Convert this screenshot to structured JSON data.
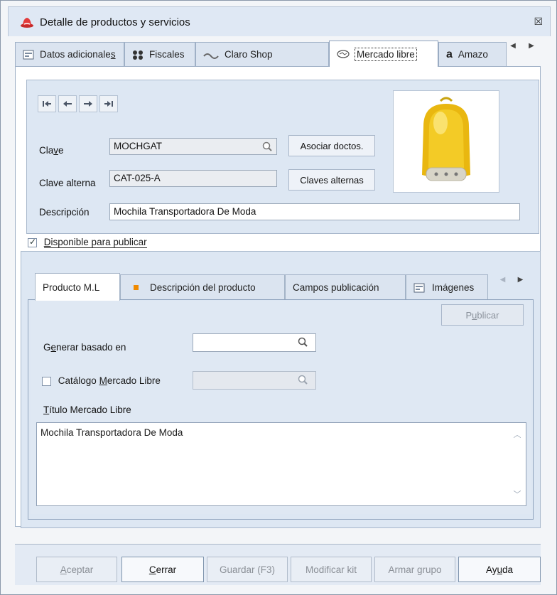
{
  "window": {
    "title": "Detalle de productos y servicios",
    "close_glyph": "☒"
  },
  "top_tabs": [
    {
      "label_pre": "Datos adicionale",
      "label_u": "s",
      "icon": "form-icon"
    },
    {
      "label": "Fiscales",
      "icon": "dots-icon"
    },
    {
      "label": "Claro Shop",
      "icon": "claro-icon"
    },
    {
      "label": "Mercado libre",
      "icon": "handshake-icon"
    },
    {
      "label": "Amazo",
      "icon": "amazon-icon"
    }
  ],
  "navigation": {
    "first": "first-record",
    "prev": "previous-record",
    "next": "next-record",
    "last": "last-record"
  },
  "fields": {
    "clave_label_pre": "Cla",
    "clave_label_u": "v",
    "clave_label_post": "e",
    "clave_value": "MOCHGAT",
    "clave_alterna_label": "Clave alterna",
    "clave_alterna_value": "CAT-025-A",
    "descripcion_label": "Descripción",
    "descripcion_value": "Mochila Transportadora De Moda"
  },
  "buttons": {
    "asociar": "Asociar doctos.",
    "claves_alternas": "Claves alternas"
  },
  "disponible": {
    "label_u": "D",
    "label_rest": "isponible para publicar",
    "checked": true
  },
  "inner_tabs": [
    "Producto M.L",
    "Descripción del producto",
    "Campos publicación",
    "Imágenes"
  ],
  "publicar": {
    "pre": "P",
    "u": "u",
    "post": "blicar"
  },
  "generar": {
    "pre": "G",
    "u": "e",
    "post": "nerar basado en",
    "value": ""
  },
  "catalogo": {
    "pre": "Catálogo ",
    "u": "M",
    "post": "ercado Libre",
    "checked": false
  },
  "titulo": {
    "u": "T",
    "post": "ítulo Mercado Libre",
    "value": "Mochila Transportadora De Moda"
  },
  "bottom_buttons": {
    "aceptar": {
      "u": "A",
      "rest": "ceptar"
    },
    "cerrar": {
      "u": "C",
      "rest": "errar"
    },
    "guardar": "Guardar (F3)",
    "modificar": "Modificar kit",
    "armar": "Armar grupo",
    "ayuda": {
      "pre": "Ay",
      "u": "u",
      "post": "da"
    }
  },
  "colors": {
    "accent_orange": "#f08a00",
    "panel_blue": "#dde7f3"
  }
}
